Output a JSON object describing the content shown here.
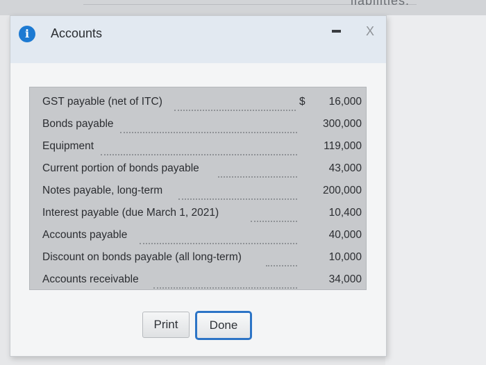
{
  "background": {
    "top_text": "liabilities."
  },
  "dialog": {
    "title": "Accounts",
    "info_icon": "i",
    "close_label": "X"
  },
  "accounts": [
    {
      "label": "GST payable (net of ITC)",
      "dollar": "$",
      "value": "16,000"
    },
    {
      "label": "Bonds payable",
      "dollar": "",
      "value": "300,000"
    },
    {
      "label": "Equipment",
      "dollar": "",
      "value": "119,000"
    },
    {
      "label": "Current portion of bonds payable",
      "dollar": "",
      "value": "43,000"
    },
    {
      "label": "Notes payable, long-term",
      "dollar": "",
      "value": "200,000"
    },
    {
      "label": "Interest payable (due March 1, 2021)",
      "dollar": "",
      "value": "10,400"
    },
    {
      "label": "Accounts payable",
      "dollar": "",
      "value": "40,000"
    },
    {
      "label": "Discount on bonds payable (all long-term)",
      "dollar": "",
      "value": "10,000"
    },
    {
      "label": "Accounts receivable",
      "dollar": "",
      "value": "34,000"
    }
  ],
  "buttons": {
    "print_label": "Print",
    "done_label": "Done"
  },
  "colors": {
    "accent": "#2c74c6",
    "info_icon_bg": "#1d7ad2",
    "titlebar_bg": "#e2e9f1",
    "table_bg": "#c7c9cc"
  }
}
